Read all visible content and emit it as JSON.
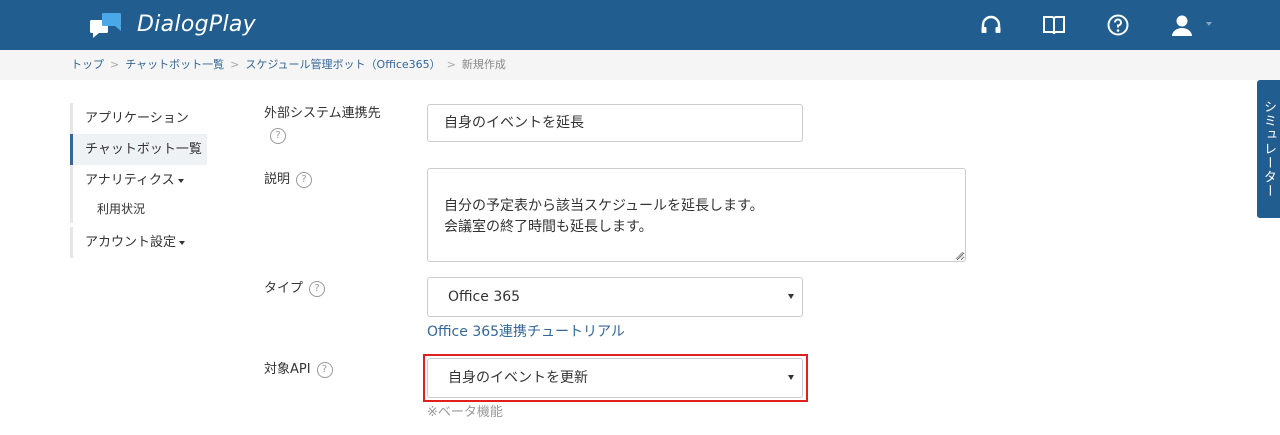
{
  "header": {
    "brand": "DialogPlay",
    "icons": [
      "headset-icon",
      "book-icon",
      "help-circle-icon",
      "user-icon"
    ]
  },
  "breadcrumb": {
    "items": [
      "トップ",
      "チャットボット一覧",
      "スケジュール管理ボット（Office365）"
    ],
    "current": "新規作成",
    "separator": ">"
  },
  "sidenav": {
    "items": [
      {
        "label": "アプリケーション"
      },
      {
        "label": "チャットボット一覧",
        "active": true
      },
      {
        "label": "アナリティクス"
      },
      {
        "label": "利用状況"
      },
      {
        "label": "アカウント設定"
      }
    ]
  },
  "form": {
    "external_system": {
      "label": "外部システム連携先",
      "value": "自身のイベントを延長"
    },
    "description": {
      "label": "説明",
      "value": "自分の予定表から該当スケジュールを延長します。\n会議室の終了時間も延長します。"
    },
    "type": {
      "label": "タイプ",
      "value": "Office 365",
      "tutorial_link": "Office 365連携チュートリアル"
    },
    "target_api": {
      "label": "対象API",
      "value": "自身のイベントを更新",
      "note": "※ベータ機能"
    }
  },
  "help_glyph": "?",
  "simulator": {
    "label": "シミュレーター"
  },
  "colors": {
    "header_bg": "#215d8f",
    "link": "#336699",
    "highlight": "#e02020"
  }
}
